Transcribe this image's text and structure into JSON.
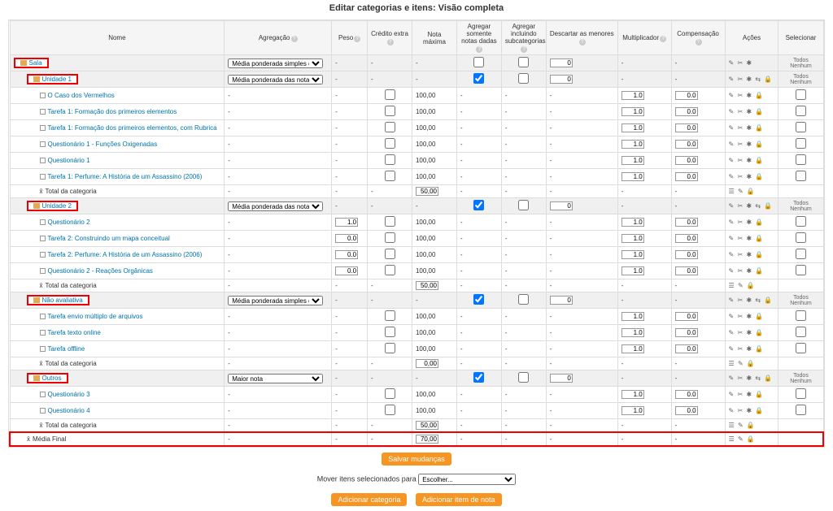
{
  "page_title": "Editar categorias e itens: Visão completa",
  "headers": {
    "name": "Nome",
    "agg": "Agregação",
    "peso": "Peso",
    "cred": "Crédito extra",
    "notam": "Nota máxima",
    "agg1": "Agregar somente notas dadas",
    "agg2": "Agregar incluindo subcategorias",
    "desc": "Descartar as menores",
    "mult": "Multiplicador",
    "comp": "Compensação",
    "acoes": "Ações",
    "sel": "Selecionar"
  },
  "agg_options": {
    "media_simples": "Média ponderada simples das notas",
    "media_pond": "Média ponderada das notas",
    "maior": "Maior nota"
  },
  "categories": [
    {
      "name": "Sala",
      "redbox": true,
      "aggregation": "media_simples",
      "agg1_checked": false,
      "agg2_checked": false,
      "dropzero": "0",
      "acoes": "✎ ✂ ✱",
      "sel": "Todos Nenhum",
      "items": []
    },
    {
      "name": "Unidade 1",
      "redbox": true,
      "aggregation": "media_pond",
      "agg1_checked": true,
      "agg2_checked": false,
      "dropzero": "0",
      "acoes": "✎ ✂ ✱ ⇆ 🔒",
      "sel": "Todos Nenhum",
      "items": [
        {
          "name": "O Caso dos Vermelhos",
          "notam": "100,00",
          "mult": "1.0",
          "comp": "0.0"
        },
        {
          "name": "Tarefa 1: Formação dos primeiros elementos",
          "notam": "100,00",
          "mult": "1.0",
          "comp": "0.0"
        },
        {
          "name": "Tarefa 1: Formação dos primeiros elementos, com Rubrica",
          "notam": "100,00",
          "mult": "1.0",
          "comp": "0.0"
        },
        {
          "name": "Questionário 1 - Funções Oxigenadas",
          "notam": "100,00",
          "mult": "1.0",
          "comp": "0.0"
        },
        {
          "name": "Questionário 1",
          "notam": "100,00",
          "mult": "1.0",
          "comp": "0.0"
        },
        {
          "name": "Tarefa 1: Perfume: A História de um Assassino (2006)",
          "notam": "100,00",
          "mult": "1.0",
          "comp": "0.0"
        }
      ],
      "total_label": "Total da categoria",
      "total_val": "50,00"
    },
    {
      "name": "Unidade 2",
      "redbox": true,
      "aggregation": "media_pond",
      "agg1_checked": true,
      "agg2_checked": false,
      "dropzero": "0",
      "acoes": "✎ ✂ ✱ ⇆ 🔒",
      "sel": "Todos Nenhum",
      "items": [
        {
          "name": "Questionário 2",
          "peso": "1.0",
          "notam": "100,00",
          "mult": "1.0",
          "comp": "0.0"
        },
        {
          "name": "Tarefa 2: Construindo um mapa conceitual",
          "peso": "0.0",
          "notam": "100,00",
          "mult": "1.0",
          "comp": "0.0"
        },
        {
          "name": "Tarefa 2: Perfume: A História de um Assassino (2006)",
          "peso": "0.0",
          "notam": "100,00",
          "mult": "1.0",
          "comp": "0.0"
        },
        {
          "name": "Questionário 2 - Reações Orgânicas",
          "peso": "0.0",
          "notam": "100,00",
          "mult": "1.0",
          "comp": "0.0"
        }
      ],
      "total_label": "Total da categoria",
      "total_val": "50,00"
    },
    {
      "name": "Não avaliativa",
      "redbox": true,
      "aggregation": "media_simples",
      "agg1_checked": true,
      "agg2_checked": false,
      "dropzero": "0",
      "acoes": "✎ ✂ ✱ ⇆ 🔒",
      "sel": "Todos Nenhum",
      "items": [
        {
          "name": "Tarefa envio múltiplo de arquivos",
          "notam": "100,00",
          "mult": "1.0",
          "comp": "0.0"
        },
        {
          "name": "Tarefa texto online",
          "notam": "100,00",
          "mult": "1.0",
          "comp": "0.0"
        },
        {
          "name": "Tarefa offline",
          "notam": "100,00",
          "mult": "1.0",
          "comp": "0.0"
        }
      ],
      "total_label": "Total da categoria",
      "total_val": "0,00"
    },
    {
      "name": "Outros",
      "redbox": true,
      "aggregation": "maior",
      "agg1_checked": true,
      "agg2_checked": false,
      "dropzero": "0",
      "acoes": "✎ ✂ ✱ ⇆ 🔒",
      "sel": "Todos Nenhum",
      "items": [
        {
          "name": "Questionário 3",
          "notam": "100,00",
          "mult": "1.0",
          "comp": "0.0"
        },
        {
          "name": "Questionário 4",
          "notam": "100,00",
          "mult": "1.0",
          "comp": "0.0"
        }
      ],
      "total_label": "Total da categoria",
      "total_val": "50,00"
    }
  ],
  "final": {
    "name": "Média Final",
    "notam": "70,00"
  },
  "buttons": {
    "save": "Salvar mudanças",
    "move_label": "Mover itens selecionados para",
    "move_choose": "Escolher...",
    "add_cat": "Adicionar categoria",
    "add_item": "Adicionar item de nota"
  },
  "icons": {
    "item_actions": "✎ ✂ ✱ 🔒",
    "total_actions": "☰ ✎ 🔒"
  }
}
